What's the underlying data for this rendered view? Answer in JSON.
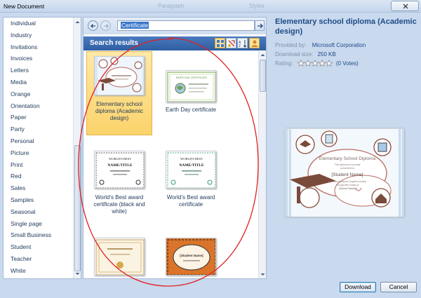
{
  "window": {
    "title": "New Document",
    "faded_labels": [
      "Paragraph",
      "Styles"
    ]
  },
  "sidebar": {
    "items": [
      "Individual",
      "Industry",
      "Invitations",
      "Invoices",
      "Letters",
      "Media",
      "Orange",
      "Orientation",
      "Paper",
      "Party",
      "Personal",
      "Picture",
      "Print",
      "Red",
      "Sales",
      "Samples",
      "Seasonal",
      "Single page",
      "Small Business",
      "Student",
      "Teacher",
      "White"
    ]
  },
  "search": {
    "value": "Certificate"
  },
  "results": {
    "title": "Search results",
    "tiles": [
      {
        "label": "Elementary school diploma (Academic design)",
        "selected": true
      },
      {
        "label": "Earth Day certificate",
        "selected": false
      },
      {
        "label": "World's Best award certificate (black and white)",
        "selected": false
      },
      {
        "label": "World's Best award certificate",
        "selected": false
      },
      {
        "label": "",
        "selected": false
      },
      {
        "label": "",
        "selected": false
      }
    ],
    "thumb_texts": {
      "earth_day": "EARTH DAY CERTIFICATE",
      "worlds_best": "WORLD'S BEST",
      "name_title": "NAME/TITLE",
      "student_name": "[Student Name]"
    }
  },
  "details": {
    "title": "Elementary school diploma (Academic design)",
    "provided_by_label": "Provided by:",
    "provided_by": "Microsoft Corporation",
    "download_size_label": "Download size:",
    "download_size": "250 KB",
    "rating_label": "Rating:",
    "rating_votes": "(0 Votes)",
    "rating_value": 0,
    "preview": {
      "heading": "Elementary School Diploma",
      "line1": "This diploma is proudly",
      "line2": "presented to",
      "student": "[Student Name]",
      "line3": "For Completing the required studies",
      "line4": "through fifth Grade at",
      "school": "[School Name]"
    }
  },
  "buttons": {
    "download": "Download",
    "cancel": "Cancel"
  },
  "colors": {
    "accent": "#2f5ea2",
    "selection": "#fbd36a",
    "annotation": "#e02020"
  }
}
